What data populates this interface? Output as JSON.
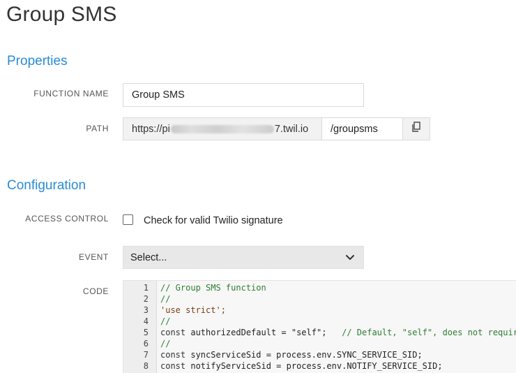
{
  "page": {
    "title": "Group SMS"
  },
  "properties": {
    "section_title": "Properties",
    "function_name_label": "FUNCTION NAME",
    "function_name_value": "Group SMS",
    "path_label": "PATH",
    "path_prefix_start": "https://pi",
    "path_prefix_end": "7.twil.io",
    "path_value": "/groupsms"
  },
  "configuration": {
    "section_title": "Configuration",
    "access_control_label": "ACCESS CONTROL",
    "access_control_checkbox_label": "Check for valid Twilio signature",
    "access_control_checked": false,
    "event_label": "EVENT",
    "event_select_value": "Select...",
    "code_label": "CODE"
  },
  "code": {
    "lines": [
      {
        "num": "1",
        "kw": "",
        "code": "",
        "comment": "// Group SMS function"
      },
      {
        "num": "2",
        "kw": "",
        "code": "",
        "comment": "//"
      },
      {
        "num": "3",
        "kw": "",
        "code": "'use strict';",
        "comment": ""
      },
      {
        "num": "4",
        "kw": "",
        "code": "",
        "comment": "//"
      },
      {
        "num": "5",
        "kw": "const",
        "code": " authorizedDefault = \"self\";   ",
        "comment": "// Default, \"self\", does not require"
      },
      {
        "num": "6",
        "kw": "",
        "code": "",
        "comment": "//"
      },
      {
        "num": "7",
        "kw": "const",
        "code": " syncServiceSid = process.env.SYNC_SERVICE_SID;",
        "comment": ""
      },
      {
        "num": "8",
        "kw": "const",
        "code": " notifyServiceSid = process.env.NOTIFY_SERVICE_SID;",
        "comment": ""
      }
    ]
  },
  "colors": {
    "accent": "#2a8bd3",
    "comment": "#2f7d32"
  }
}
